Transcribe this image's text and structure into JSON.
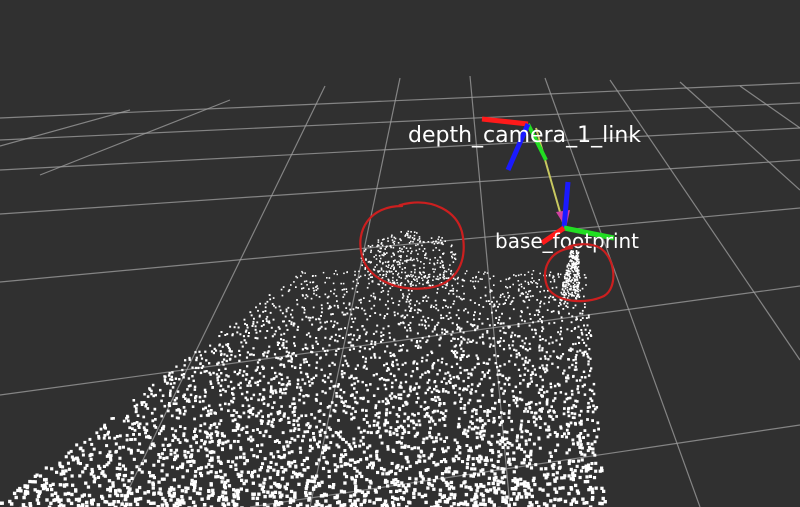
{
  "viewport": {
    "background_color": "#303030",
    "grid_color": "#a0a0a0"
  },
  "frames": [
    {
      "name": "depth_camera_1_link",
      "axis_colors": {
        "x": "#ff0000",
        "y": "#00ff00",
        "z": "#0000ff"
      }
    },
    {
      "name": "base_footprint",
      "axis_colors": {
        "x": "#ff0000",
        "y": "#00ff00",
        "z": "#0000ff"
      }
    }
  ],
  "tf_link_color": "#cccc55",
  "point_cloud": {
    "color": "#ffffff",
    "description_type": "PointCloud2"
  },
  "annotations": {
    "circle_color": "#cc1f1f",
    "count": 2
  }
}
